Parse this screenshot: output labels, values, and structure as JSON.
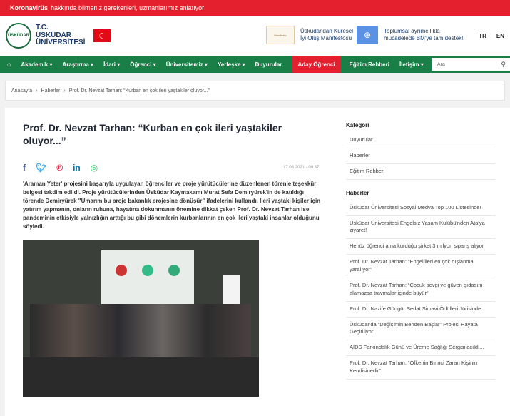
{
  "topbar": {
    "bold": "Koronavirüs",
    "text": "hakkında bilmeniz gerekenleri, uzmanlarımız anlatıyor"
  },
  "logo": {
    "circle": "ÜSKÜDAR",
    "line1": "T.C.",
    "line2": "ÜSKÜDAR",
    "line3": "ÜNİVERSİTESİ"
  },
  "promos": [
    {
      "text": "Üsküdar'dan Küresel İyi Oluş Manifestosu",
      "box": "Manifesto"
    },
    {
      "text": "Toplumsal ayrımcılıkla mücadelede BM'ye tam destek!"
    }
  ],
  "languages": [
    "TR",
    "EN"
  ],
  "nav": {
    "items": [
      "Akademik ▾",
      "Araştırma ▾",
      "İdari ▾",
      "Öğrenci ▾",
      "Üniversitemiz ▾",
      "Yerleşke ▾",
      "Duyurular",
      "Aday Öğrenci",
      "Eğitim Rehberi",
      "İletişim ▾"
    ],
    "search_placeholder": "Ara"
  },
  "breadcrumb": [
    "Anasayfa",
    "Haberler",
    "Prof. Dr. Nevzat Tarhan: “Kurban en çok ileri yaştakiler oluyor...”"
  ],
  "article": {
    "title": "Prof. Dr. Nevzat Tarhan: “Kurban en çok ileri yaştakiler oluyor...”",
    "date": "17.08.2021 - 09:37",
    "lead": "'Araman Yeter' projesini başarıyla uygulayan öğrenciler ve proje yürütücülerine düzenlenen törenle teşekkür belgesi takdim edildi. Proje yürütücülerinden Üsküdar Kaymakamı Murat Sefa Demiryürek'in de katıldığı törende Demiryürek \"Umarım bu proje bakanlık projesine dönüşür\" ifadelerini kullandı. İleri yaştaki kişiler için yatırım yapmanın, onların ruhuna, hayatına dokunmanın önemine dikkat çeken Prof. Dr. Nevzat Tarhan ise pandeminin etkisiyle yalnızlığın arttığı bu gibi dönemlerin kurbanlarının en çok ileri yaştaki insanlar olduğunu söyledi."
  },
  "share_icons": [
    {
      "name": "facebook-icon",
      "glyph": "f",
      "color": "#3b5998"
    },
    {
      "name": "twitter-icon",
      "glyph": "🐦",
      "color": "#1da1f2"
    },
    {
      "name": "pinterest-icon",
      "glyph": "℗",
      "color": "#e60023"
    },
    {
      "name": "linkedin-icon",
      "glyph": "in",
      "color": "#0077b5"
    },
    {
      "name": "whatsapp-icon",
      "glyph": "◎",
      "color": "#25d366"
    }
  ],
  "sidebar": {
    "category_title": "Kategori",
    "categories": [
      "Duyurular",
      "Haberler",
      "Eğitim Rehberi"
    ],
    "news_title": "Haberler",
    "news": [
      "Üsküdar Üniversitesi Sosyal Medya Top 100 Listesinde!",
      "Üsküdar Üniversitesi Engelsiz Yaşam Kulübü'nden Ata'ya ziyaret!",
      "Henüz öğrenci ama kurduğu şirket 3 milyon sipariş alıyor",
      "Prof. Dr. Nevzat Tarhan: “Engellileri en çok dışlanma yaralıyor”",
      "Prof. Dr. Nevzat Tarhan: “Çocuk sevgi ve güven gıdasını alamazsa travmalar içinde büyür”",
      "Prof. Dr. Nazife Güngör Sedat Simavi Ödülleri Jürisinde...",
      "Üsküdar'da “Değişimin Benden Başlar” Projesi Hayata Geçiriliyor",
      "AIDS Farkındalık Günü ve Üreme Sağlığı Sergisi açıldı...",
      "Prof. Dr. Nevzat Tarhan: “Öfkenin Birinci Zararı Kişinin Kendisinedir”"
    ]
  },
  "colors": {
    "red": "#e5202e",
    "green": "#1a7f46"
  }
}
